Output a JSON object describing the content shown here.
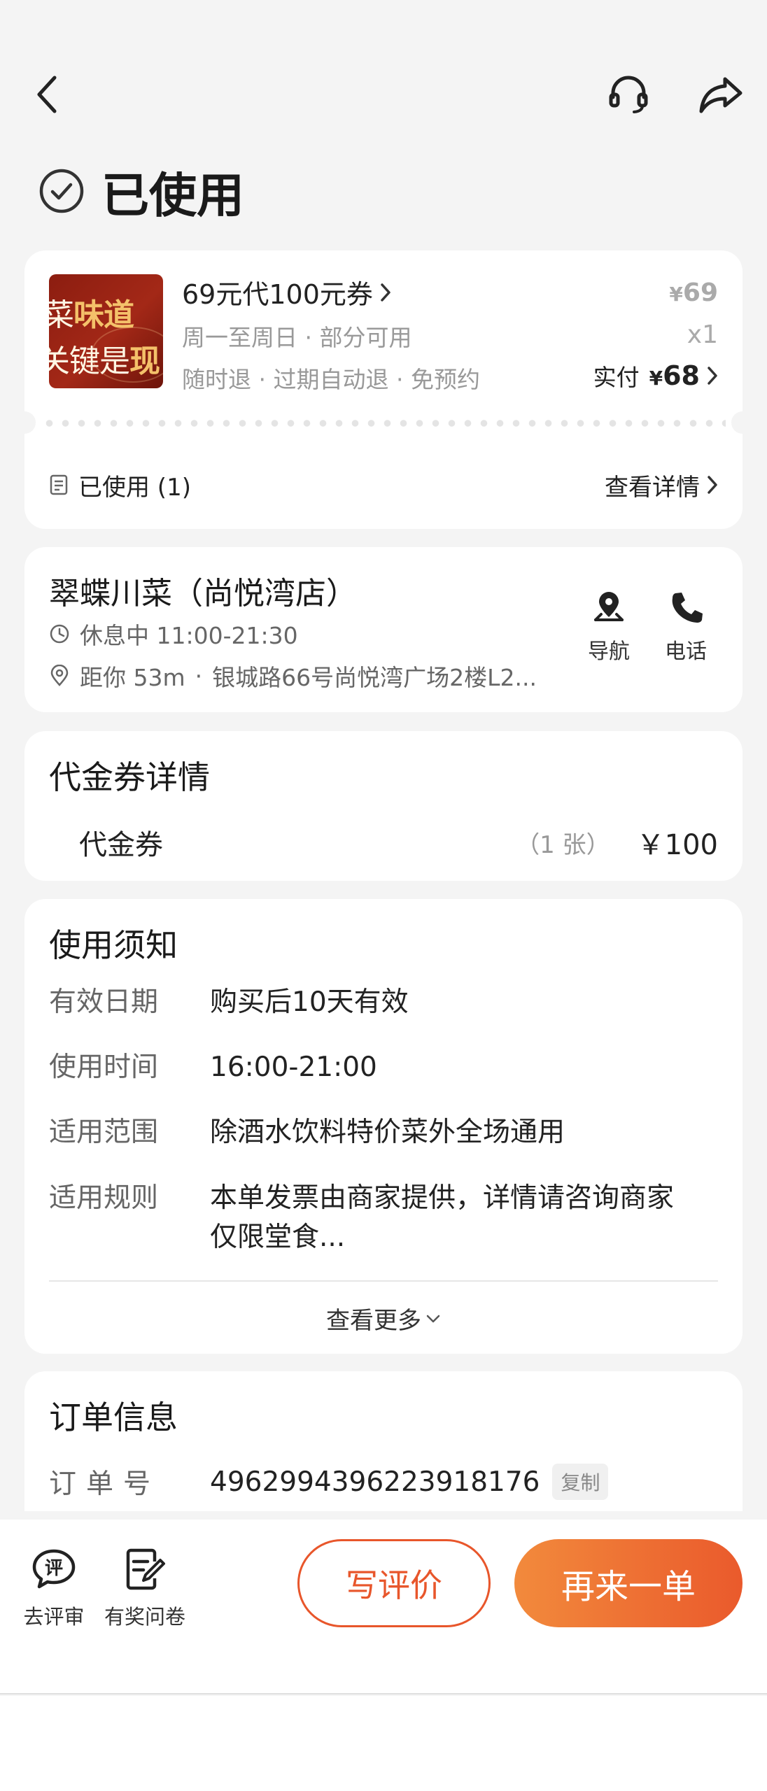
{
  "status": {
    "title": "已使用"
  },
  "deal": {
    "name": "69元代100元券",
    "thumb_text_1a": "菜",
    "thumb_text_1b": "味道",
    "thumb_text_2a": "关键是",
    "thumb_text_2b": "现",
    "line1": "周一至周日 · 部分可用",
    "line2": "随时退 · 过期自动退 · 免预约",
    "price_yen": "¥",
    "price_original": "69",
    "quantity": "x1",
    "paid_label": "实付",
    "paid_yen": "¥",
    "paid_amount": "68",
    "used_label": "已使用 (1)",
    "detail_link": "查看详情"
  },
  "store": {
    "name": "翠蝶川菜（尚悦湾店）",
    "hours": "休息中 11:00-21:30",
    "distance": "距你 53m",
    "separator": "·",
    "address": "银城路66号尚悦湾广场2楼L2...",
    "nav_label": "导航",
    "phone_label": "电话"
  },
  "voucher": {
    "title": "代金券详情",
    "item_name": "代金券",
    "item_count": "（1 张）",
    "item_amount": "￥100"
  },
  "notice": {
    "title": "使用须知",
    "rows": [
      {
        "key": "有效日期",
        "value": "购买后10天有效"
      },
      {
        "key": "使用时间",
        "value": "16:00-21:00"
      },
      {
        "key": "适用范围",
        "value": "除酒水饮料特价菜外全场通用"
      },
      {
        "key": "适用规则",
        "value": "本单发票由商家提供，详情请咨询商家",
        "value2": "仅限堂食..."
      }
    ],
    "see_more": "查看更多"
  },
  "order": {
    "title": "订单信息",
    "no_label": "订单号",
    "no_value": "4962994396223918176",
    "copy_label": "复制"
  },
  "bottom": {
    "review_label": "去评审",
    "survey_label": "有奖问卷",
    "write_review": "写评价",
    "reorder": "再来一单"
  },
  "colors": {
    "accent": "#ea5a2c",
    "accent_light": "#f28a3c",
    "background": "#f4f4f4"
  }
}
